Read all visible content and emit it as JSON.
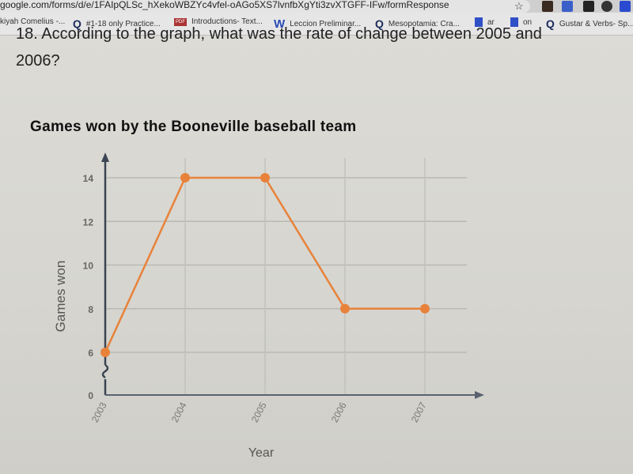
{
  "browser": {
    "url": "google.com/forms/d/e/1FAIpQLSc_hXekoWBZYc4vfel-oAGo5XS7lvnfbXgYti3zvXTGFF-IFw/formResponse",
    "bookmarks": [
      {
        "icon": "person-icon",
        "label": "kiyah Comelius -..."
      },
      {
        "icon": "quizlet-icon",
        "label": "#1-18 only Practice..."
      },
      {
        "icon": "pdf-icon",
        "label": "Introductions- Text..."
      },
      {
        "icon": "word-icon",
        "label": "Leccion Preliminar..."
      },
      {
        "icon": "quizlet-icon",
        "label": "Mesopotamia: Cra..."
      },
      {
        "icon": "doc-icon",
        "label": "ar"
      },
      {
        "icon": "doc-icon",
        "label": "on"
      },
      {
        "icon": "quizlet-icon",
        "label": "Gustar & Verbs- Sp..."
      }
    ]
  },
  "question": {
    "line1": "18. According to the graph, what was the rate of change between 2005 and",
    "line2": "2006?"
  },
  "chart_data": {
    "type": "line",
    "title": "Games won by the Booneville baseball team",
    "xlabel": "Year",
    "ylabel": "Games won",
    "categories": [
      "2003",
      "2004",
      "2005",
      "2006",
      "2007"
    ],
    "series": [
      {
        "name": "Games won",
        "values": [
          6,
          14,
          14,
          8,
          8
        ],
        "color": "#e8823a"
      }
    ],
    "yticks": [
      0,
      6,
      8,
      10,
      12,
      14
    ],
    "ylim": [
      0,
      14
    ],
    "axis_break": true,
    "grid": true
  }
}
